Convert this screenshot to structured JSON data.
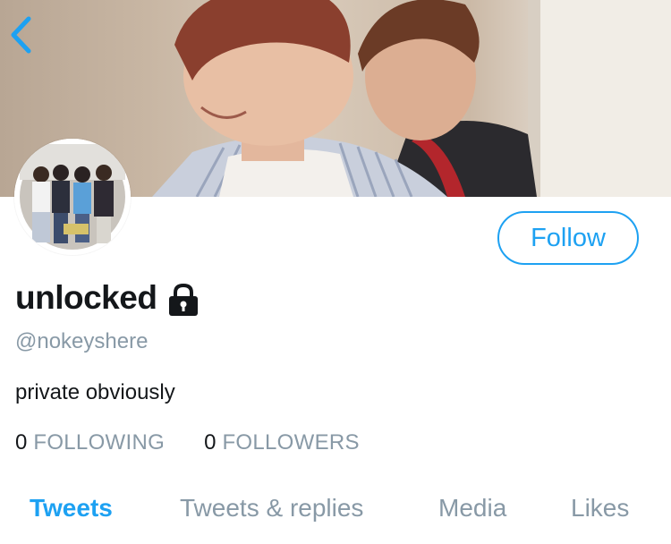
{
  "profile": {
    "display_name": "unlocked",
    "handle": "@nokeyshere",
    "bio": "private obviously",
    "protected": true
  },
  "stats": {
    "following_count": "0",
    "following_label": "FOLLOWING",
    "followers_count": "0",
    "followers_label": "FOLLOWERS"
  },
  "actions": {
    "follow_label": "Follow"
  },
  "tabs": [
    {
      "label": "Tweets",
      "active": true
    },
    {
      "label": "Tweets & replies",
      "active": false
    },
    {
      "label": "Media",
      "active": false
    },
    {
      "label": "Likes",
      "active": false
    }
  ],
  "icons": {
    "back": "chevron-left-icon",
    "lock": "lock-icon"
  },
  "colors": {
    "accent": "#1da1f2",
    "secondary_text": "#8899a6",
    "primary_text": "#14171a"
  }
}
